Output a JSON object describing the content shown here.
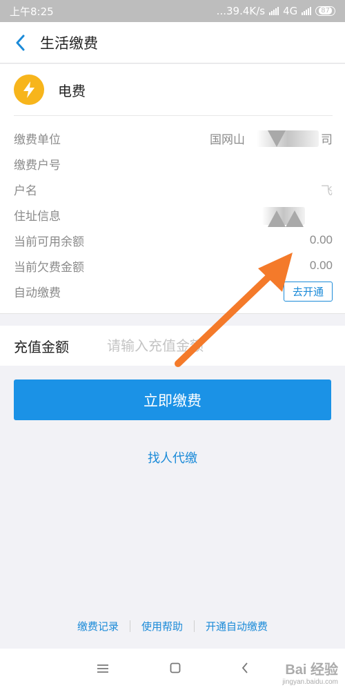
{
  "status_bar": {
    "time": "上午8:25",
    "network_speed": "...39.4K/s",
    "network_type": "4G",
    "battery_level": "87"
  },
  "nav": {
    "title": "生活缴费"
  },
  "biller": {
    "name": "电费",
    "icon": "lightning-bolt-icon",
    "icon_color": "#f7b51c"
  },
  "info": {
    "unit_label": "缴费单位",
    "unit_value": "国网山",
    "unit_value_tail": "司",
    "account_label": "缴费户号",
    "name_label": "户名",
    "name_value": "飞",
    "address_label": "住址信息",
    "balance_label": "当前可用余额",
    "balance_value": "0.00",
    "arrears_label": "当前欠费金额",
    "arrears_value": "0.00",
    "autopay_label": "自动缴费",
    "autopay_button": "去开通"
  },
  "recharge": {
    "label": "充值金额",
    "placeholder": "请输入充值金额"
  },
  "actions": {
    "pay_now": "立即缴费",
    "pay_for_others": "找人代缴"
  },
  "footer": {
    "records": "缴费记录",
    "help": "使用帮助",
    "autopay": "开通自动缴费"
  },
  "watermark": {
    "main": "Bai 经验",
    "sub": "jingyan.baidu.com"
  },
  "colors": {
    "accent": "#1b92e6",
    "link": "#1a8ad8",
    "annotation_arrow": "#f47a2a"
  }
}
